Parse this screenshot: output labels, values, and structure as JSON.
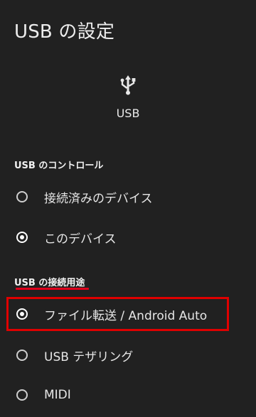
{
  "page": {
    "title": "USB の設定"
  },
  "hero": {
    "icon": "usb-icon",
    "label": "USB"
  },
  "sections": {
    "control": {
      "header": "USB のコントロール",
      "options": [
        {
          "label": "接続済みのデバイス",
          "selected": false
        },
        {
          "label": "このデバイス",
          "selected": true
        }
      ]
    },
    "purpose": {
      "header": "USB の接続用途",
      "options": [
        {
          "label": "ファイル転送 / Android Auto",
          "selected": true
        },
        {
          "label": "USB テザリング",
          "selected": false
        },
        {
          "label": "MIDI",
          "selected": false
        }
      ]
    }
  },
  "colors": {
    "background": "#212121",
    "text": "#e8e8e8",
    "annotation_red": "#e00000"
  }
}
